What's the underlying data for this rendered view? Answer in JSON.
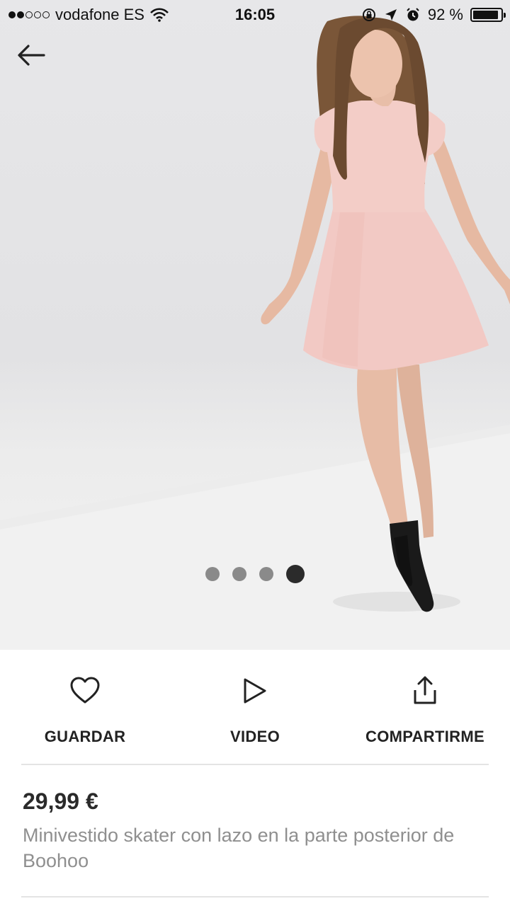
{
  "status_bar": {
    "carrier": "vodafone ES",
    "time": "16:05",
    "battery": "92 %",
    "battery_level": 0.92,
    "signal_bars_filled": 2,
    "signal_bars_total": 5,
    "icons": [
      "wifi-icon",
      "orientation-lock-icon",
      "location-arrow-icon",
      "alarm-icon",
      "battery-icon"
    ]
  },
  "gallery": {
    "image_count": 4,
    "active_index": 3
  },
  "actions": {
    "save": {
      "label": "GUARDAR",
      "icon": "heart-icon"
    },
    "video": {
      "label": "VIDEO",
      "icon": "play-icon"
    },
    "share": {
      "label": "COMPARTIRME",
      "icon": "share-icon"
    }
  },
  "product": {
    "price": "29,99 €",
    "description": "Minivestido skater con lazo en la parte posterior de Boohoo"
  },
  "colors": {
    "accent": "#222222",
    "dress": "#f2c9c4",
    "pager_inactive": "#8a8a8a",
    "pager_active": "#2b2b2b"
  }
}
